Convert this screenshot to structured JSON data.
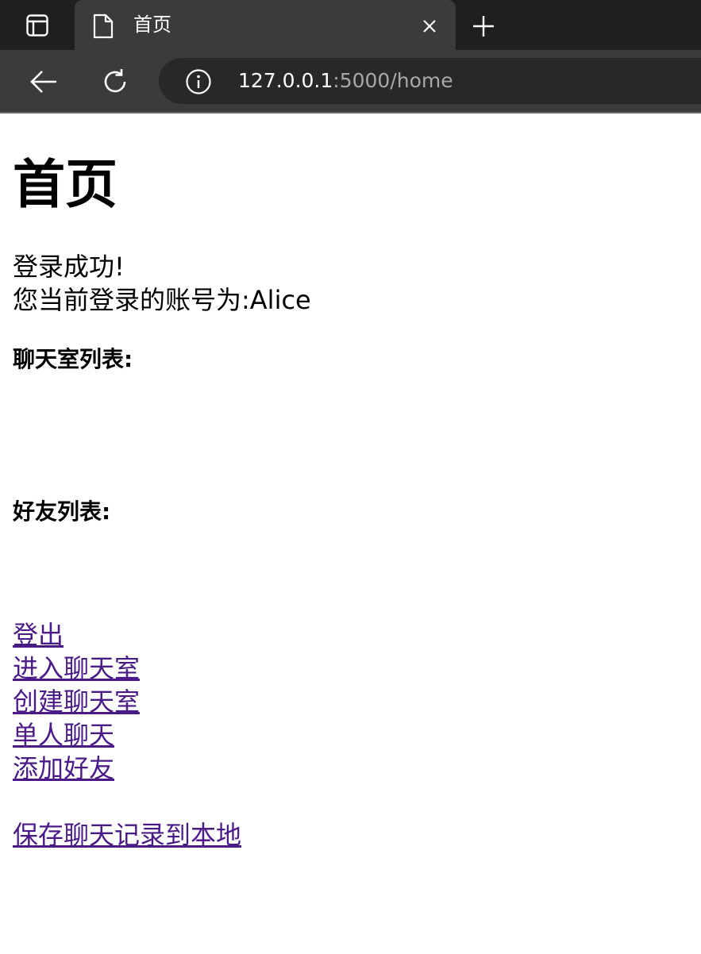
{
  "browser": {
    "tab": {
      "title": "首页"
    },
    "address": {
      "host": "127.0.0.1",
      "rest": ":5000/home"
    },
    "icons": [
      "tab-actions-icon",
      "document-icon",
      "close-icon",
      "plus-icon",
      "back-arrow-icon",
      "reload-icon",
      "info-icon"
    ]
  },
  "page": {
    "title": "首页",
    "login_status": "登录成功!",
    "account_line": "您当前登录的账号为:Alice",
    "chatrooms_heading": "聊天室列表:",
    "friends_heading": "好友列表:",
    "links": {
      "logout": "登出",
      "enter_chatroom": "进入聊天室",
      "create_chatroom": "创建聊天室",
      "private_chat": "单人聊天",
      "add_friend": "添加好友",
      "save_history": "保存聊天记录到本地"
    },
    "link_color": "#4a1a86"
  }
}
